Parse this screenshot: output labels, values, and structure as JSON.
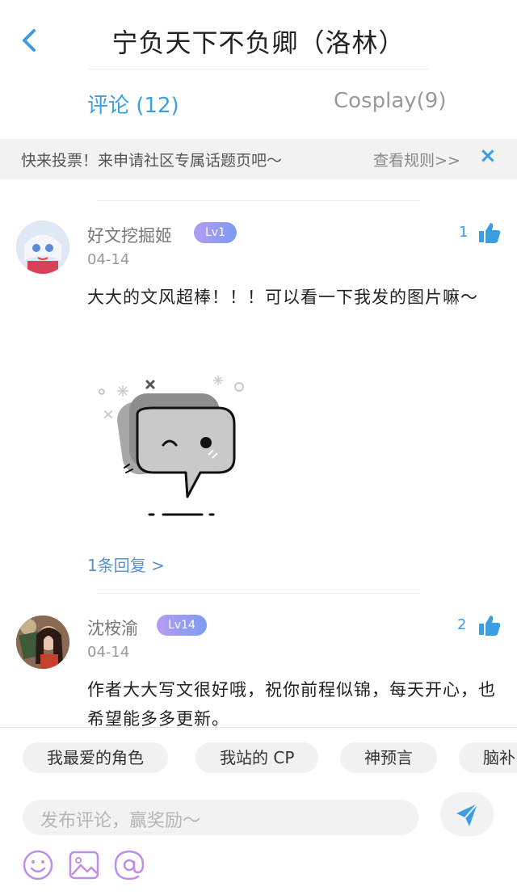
{
  "header": {
    "title": "宁负天下不负卿（洛林）"
  },
  "tabs": [
    {
      "label": "评论 (12)",
      "active": true
    },
    {
      "label": "Cosplay(9)",
      "active": false
    }
  ],
  "notice": {
    "text": "快来投票！来申请社区专属话题页吧～",
    "rules": "查看规则>>",
    "close": "×"
  },
  "comments": [
    {
      "user": "好文挖掘姬",
      "level": "Lv1",
      "date": "04-14",
      "likes": "1",
      "text": "大大的文风超棒！！！可以看一下我发的图片嘛～",
      "reply": "1条回复 >"
    },
    {
      "user": "沈桉渝",
      "level": "Lv14",
      "date": "04-14",
      "likes": "2",
      "text": "作者大大写文很好哦，祝你前程似锦，每天开心，也希望能多多更新。"
    }
  ],
  "quick_tags": [
    "我最爱的角色",
    "我站的 CP",
    "神预言",
    "脑补"
  ],
  "composer": {
    "placeholder": "发布评论，赢奖励～"
  },
  "colors": {
    "accent": "#3a9ee4",
    "level_badge": "#9c9cf2",
    "tool_icons": "#c08ee6"
  },
  "icons": [
    "back-chevron-icon",
    "close-icon",
    "thumb-up-icon",
    "send-icon",
    "emoji-icon",
    "image-icon",
    "at-icon"
  ]
}
